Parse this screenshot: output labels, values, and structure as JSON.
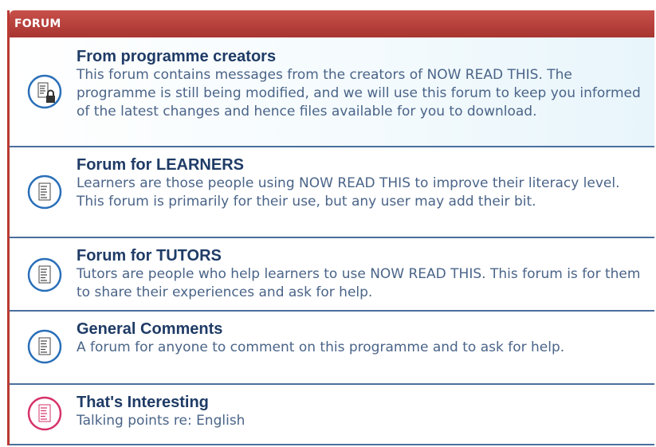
{
  "header": {
    "title": "FORUM"
  },
  "forums": [
    {
      "title": "From programme creators",
      "description": "This forum contains messages from the creators of NOW READ THIS. The programme is still being modified, and we will use this forum to keep you informed of the latest changes and hence files available for you to download.",
      "icon": "locked-forum-icon",
      "color": "#2a6fb8"
    },
    {
      "title": "Forum for LEARNERS",
      "description": "Learners are those people using NOW READ THIS to improve their literacy level. This forum is primarily for their use, but any user may add their bit.",
      "icon": "forum-icon",
      "color": "#2a6fb8"
    },
    {
      "title": "Forum for TUTORS",
      "description": "Tutors are people who help learners to use NOW READ THIS. This forum is for them to share their experiences and ask for help.",
      "icon": "forum-icon",
      "color": "#2a6fb8"
    },
    {
      "title": "General Comments",
      "description": "A forum for anyone to comment on this programme and to ask for help.",
      "icon": "forum-icon",
      "color": "#2a6fb8"
    },
    {
      "title": "That's Interesting",
      "description": "Talking points re: English",
      "icon": "forum-new-posts-icon",
      "color": "#d6336b"
    }
  ],
  "colors": {
    "header_bg": "#b93a35",
    "title_text": "#1f3b66",
    "desc_text": "#4a6488",
    "divider": "#4a6f9c"
  }
}
